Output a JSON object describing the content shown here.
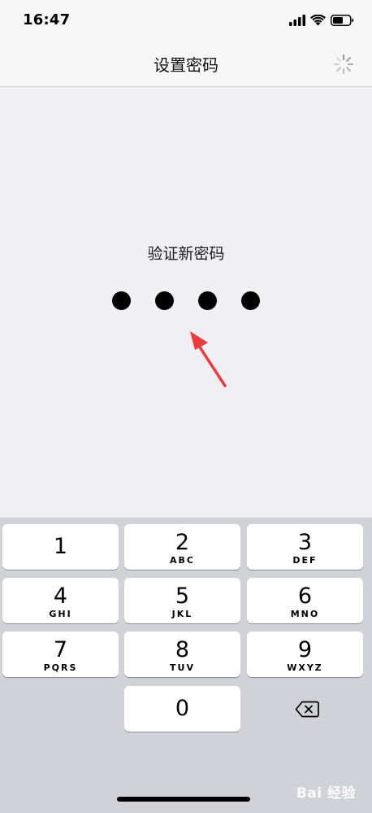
{
  "status_bar": {
    "time": "16:47",
    "icons": [
      "signal-icon",
      "wifi-icon",
      "battery-icon"
    ]
  },
  "nav": {
    "title": "设置密码",
    "right_icon": "loading-spinner-icon"
  },
  "main": {
    "prompt": "验证新密码",
    "entered_digits": 4,
    "total_digits": 4,
    "annotation": "red-arrow-icon"
  },
  "keypad": {
    "keys": [
      {
        "digit": "1",
        "letters": ""
      },
      {
        "digit": "2",
        "letters": "ABC"
      },
      {
        "digit": "3",
        "letters": "DEF"
      },
      {
        "digit": "4",
        "letters": "GHI"
      },
      {
        "digit": "5",
        "letters": "JKL"
      },
      {
        "digit": "6",
        "letters": "MNO"
      },
      {
        "digit": "7",
        "letters": "PQRS"
      },
      {
        "digit": "8",
        "letters": "TUV"
      },
      {
        "digit": "9",
        "letters": "WXYZ"
      },
      {
        "digit": "0",
        "letters": ""
      }
    ],
    "delete_icon": "backspace-icon"
  },
  "watermark": "Bai 经验",
  "colors": {
    "background": "#efeff4",
    "keypad_background": "#d1d2d7",
    "arrow": "#ee3a3a"
  }
}
